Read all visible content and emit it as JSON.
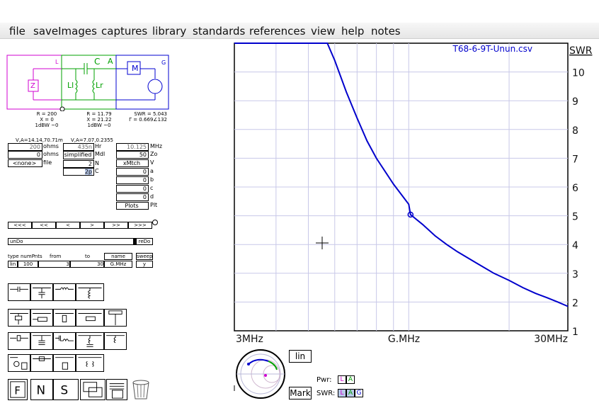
{
  "menu": [
    "file",
    "saveImages",
    "captures",
    "library",
    "standards",
    "references",
    "view",
    "help",
    "notes"
  ],
  "circuit": {
    "label_L": "L",
    "label_A": "A",
    "label_G": "G",
    "label_C": "C",
    "label_Ll": "Ll",
    "label_Lr": "Lr",
    "label_Z": "Z",
    "label_M": "M"
  },
  "readouts": {
    "col1": [
      "R = 200",
      "X = 0",
      "1dBW ~0"
    ],
    "col2": [
      "R = 11.79",
      "X = 21.22",
      "1dBW ~0"
    ],
    "col3": [
      "SWR = 5.043",
      "Γ = 0.669∠132"
    ],
    "va1": "V,A=14.14,70.71m",
    "va2": "V,A=7.07,0.2355"
  },
  "load": {
    "r_value": "200",
    "r_unit": "ohms",
    "x_value": "0",
    "x_unit": "ohms",
    "file_value": "<none>",
    "file_label": "file"
  },
  "model": {
    "hz_value": "435n",
    "hz_label": "Hr",
    "mdl_value": "simplified",
    "mdl_label": "Mdl",
    "n_value": "2",
    "n_label": "N",
    "c_value": "2p",
    "c_label": "C"
  },
  "source": {
    "mhz_value": "10.125",
    "mhz_label": "MHz",
    "zo_value": "50",
    "zo_label": "Zo",
    "v_value": "xMtch",
    "v_label": "V",
    "a_value": "0",
    "a_label": "a",
    "b_value": "0",
    "b_label": "b",
    "c_value": "0",
    "c_label": "c",
    "d_value": "0",
    "d_label": "d",
    "plots_value": "Plots",
    "plots_label": "Plt"
  },
  "nav_buttons": [
    "<<<",
    "<<",
    "<",
    ">",
    ">>",
    ">>>"
  ],
  "undo": "unDo",
  "redo": "reDo",
  "sweep": {
    "h_type": "type",
    "h_numpnts": "numPnts",
    "h_from": "from",
    "h_to": "to",
    "h_name": "name",
    "h_sweep": "sweep",
    "type": "lin",
    "numpnts": "100",
    "from": "3",
    "to": "30",
    "name": "G.MHz",
    "sweep": "y"
  },
  "chart_data": {
    "type": "line",
    "title": "T68-6-9T-Unun.csv",
    "ylabel": "SWR",
    "xlabel": "G.MHz",
    "x_tick_labels": [
      "3MHz",
      "G.MHz",
      "30MHz"
    ],
    "y_tick_labels": [
      "1",
      "2",
      "3",
      "4",
      "5",
      "6",
      "7",
      "8",
      "9",
      "10"
    ],
    "xlim": [
      3,
      30
    ],
    "ylim": [
      1,
      11
    ],
    "grid": true,
    "series": [
      {
        "values": [
          [
            3,
            11
          ],
          [
            5.7,
            11
          ],
          [
            6,
            10.4
          ],
          [
            6.5,
            9.3
          ],
          [
            7,
            8.4
          ],
          [
            7.5,
            7.6
          ],
          [
            8,
            7.0
          ],
          [
            9,
            6.1
          ],
          [
            10,
            5.4
          ],
          [
            10.125,
            5.04
          ],
          [
            11,
            4.7
          ],
          [
            12,
            4.3
          ],
          [
            13,
            4.0
          ],
          [
            14,
            3.75
          ],
          [
            16,
            3.35
          ],
          [
            18,
            3.0
          ],
          [
            20,
            2.75
          ],
          [
            22,
            2.5
          ],
          [
            24,
            2.3
          ],
          [
            26,
            2.15
          ],
          [
            28,
            2.0
          ],
          [
            30,
            1.85
          ]
        ],
        "color": "#0000cc"
      }
    ],
    "marker": {
      "x": 10.125,
      "y": 5.04
    }
  },
  "bottom": {
    "lin_button": "lin",
    "mark_button": "Mark",
    "pwr_label": "Pwr:",
    "swr_label": "SWR:",
    "pwr_l": "L",
    "pwr_a": "A",
    "swr_l": "L",
    "swr_a": "A",
    "swr_g": "G"
  }
}
